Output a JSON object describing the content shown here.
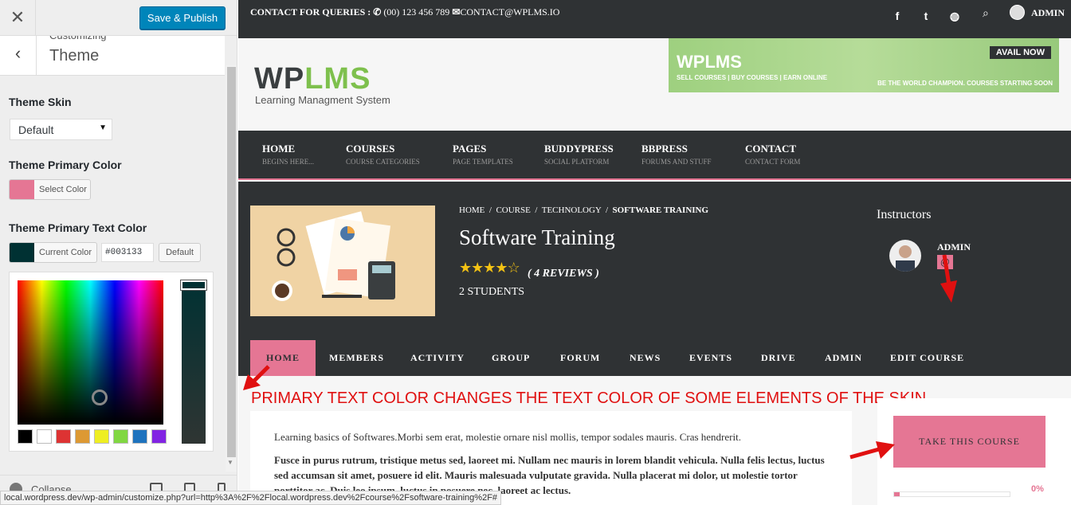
{
  "customizer": {
    "close_icon": "close-icon",
    "save_label": "Save & Publish",
    "crumb_small": "Customizing",
    "crumb_title": "Theme",
    "theme_skin_label": "Theme Skin",
    "theme_skin_value": "Default",
    "primary_color_label": "Theme Primary Color",
    "primary_color": "#e57694",
    "select_color_label": "Select Color",
    "primary_text_color_label": "Theme Primary Text Color",
    "current_color_label": "Current Color",
    "text_color_hex": "#003133",
    "default_label": "Default",
    "palette": [
      "#000000",
      "#ffffff",
      "#dd3333",
      "#dd9933",
      "#eeee22",
      "#81d742",
      "#1e73be",
      "#8224e3"
    ],
    "collapse_label": "Collapse"
  },
  "topbar": {
    "contact_prefix": "CONTACT FOR QUERIES :",
    "phone": "(00) 123 456 789",
    "email": "CONTACT@WPLMS.IO",
    "social_icons": [
      "facebook-icon",
      "twitter-icon",
      "dribbble-icon"
    ],
    "user": "ADMIN"
  },
  "header": {
    "logo_a": "WP",
    "logo_b": "LMS",
    "tagline": "Learning Managment System",
    "banner_title": "WPLMS",
    "banner_sub": "SELL COURSES | BUY COURSES | EARN ONLINE",
    "banner_btn": "AVAIL NOW",
    "banner_tag": "BE THE WORLD CHAMPION. COURSES STARTING SOON"
  },
  "nav": [
    {
      "label": "HOME",
      "sub": "BEGINS HERE..."
    },
    {
      "label": "COURSES",
      "sub": "COURSE CATEGORIES"
    },
    {
      "label": "PAGES",
      "sub": "PAGE TEMPLATES"
    },
    {
      "label": "BUDDYPRESS",
      "sub": "SOCIAL PLATFORM"
    },
    {
      "label": "BBPRESS",
      "sub": "FORUMS AND STUFF"
    },
    {
      "label": "CONTACT",
      "sub": "CONTACT FORM"
    }
  ],
  "course": {
    "crumbs": [
      "HOME",
      "COURSE",
      "TECHNOLOGY",
      "SOFTWARE TRAINING"
    ],
    "title": "Software Training",
    "rating": 4,
    "reviews": "( 4 REVIEWS )",
    "students": "2 STUDENTS",
    "instructors_heading": "Instructors",
    "instructor_name": "ADMIN",
    "instructor_at": "@"
  },
  "course_nav": [
    {
      "label": "HOME",
      "active": true
    },
    {
      "label": "MEMBERS"
    },
    {
      "label": "ACTIVITY"
    },
    {
      "label": "GROUP"
    },
    {
      "label": "FORUM"
    },
    {
      "label": "NEWS"
    },
    {
      "label": "EVENTS"
    },
    {
      "label": "DRIVE"
    },
    {
      "label": "ADMIN"
    },
    {
      "label": "EDIT COURSE"
    }
  ],
  "annotation": "PRIMARY TEXT COLOR CHANGES THE TEXT COLOR OF SOME ELEMENTS OF THE SKIN",
  "content": {
    "para1": "Learning basics of Softwares.Morbi sem erat, molestie ornare nisl mollis, tempor sodales mauris. Cras hendrerit.",
    "para2": "Fusce in purus rutrum, tristique metus sed, laoreet mi. Nullam nec mauris in lorem blandit vehicula. Nulla felis lectus, luctus sed accumsan sit amet, posuere id elit. Mauris malesuada vulputate gravida. Nulla placerat mi dolor, ut molestie tortor porttitor ac. Duis leo ipsum, luctus in posuere nec, laoreet ac lectus."
  },
  "sidebar_box": {
    "take_course": "TAKE THIS COURSE",
    "progress_pct": "0%",
    "progress": 0.05
  },
  "status_url": "local.wordpress.dev/wp-admin/customize.php?url=http%3A%2F%2Flocal.wordpress.dev%2Fcourse%2Fsoftware-training%2F#"
}
